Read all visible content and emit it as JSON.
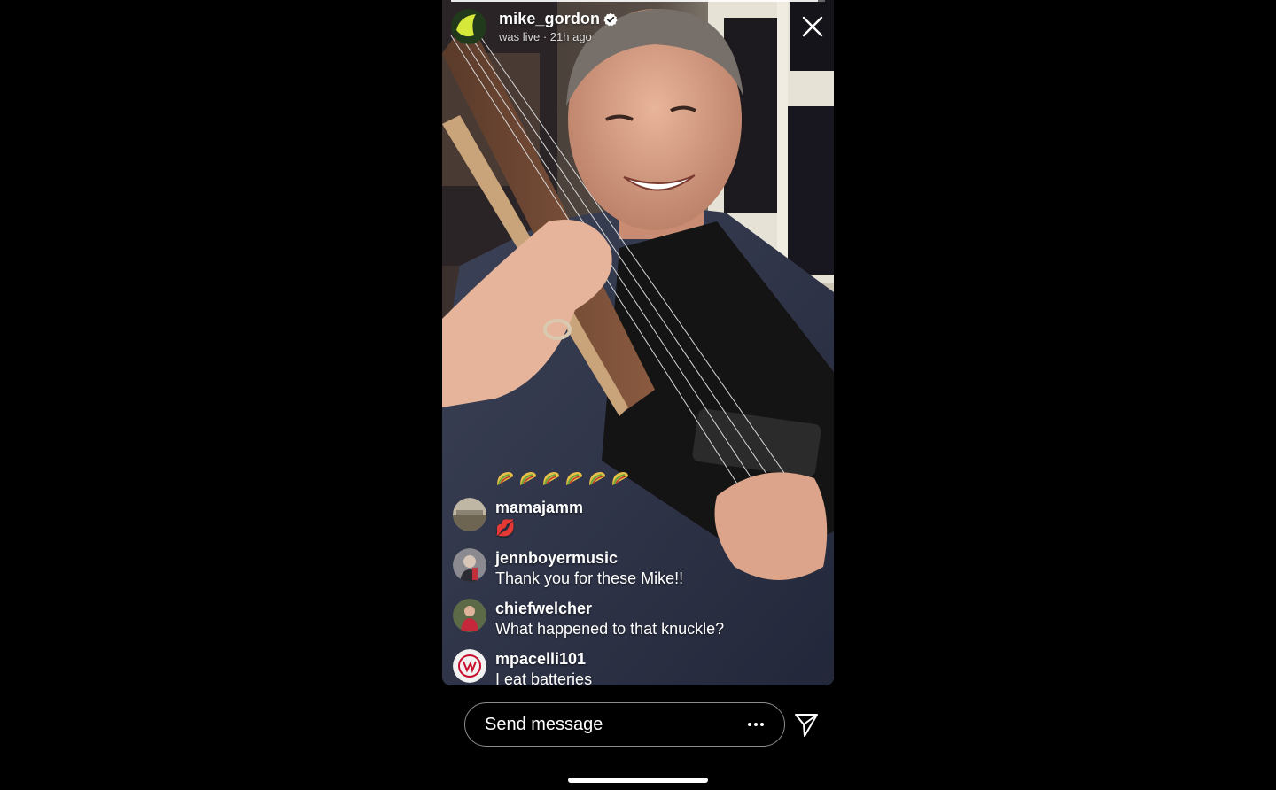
{
  "broadcast": {
    "username": "mike_gordon",
    "status": "was live · 21h ago",
    "verified": true,
    "progress_fraction": 0.98
  },
  "reactions": [
    "taco",
    "taco",
    "taco",
    "taco",
    "taco",
    "taco"
  ],
  "comments": [
    {
      "user": "mamajamm",
      "text": "💋",
      "avatar": "landscape-avatar"
    },
    {
      "user": "jennboyermusic",
      "text": "Thank you for these Mike!!",
      "avatar": "person-avatar"
    },
    {
      "user": "chiefwelcher",
      "text": "What happened to that knuckle?",
      "avatar": "person-red-avatar"
    },
    {
      "user": "mpacelli101",
      "text": "I eat batteries",
      "avatar": "red-sox-logo-avatar"
    }
  ],
  "composer": {
    "placeholder": "Send message",
    "more_icon": "ellipsis-icon",
    "send_icon": "paper-plane-icon"
  },
  "colors": {
    "background": "#000000",
    "text": "#ffffff",
    "verified_badge": "#ffffff"
  }
}
